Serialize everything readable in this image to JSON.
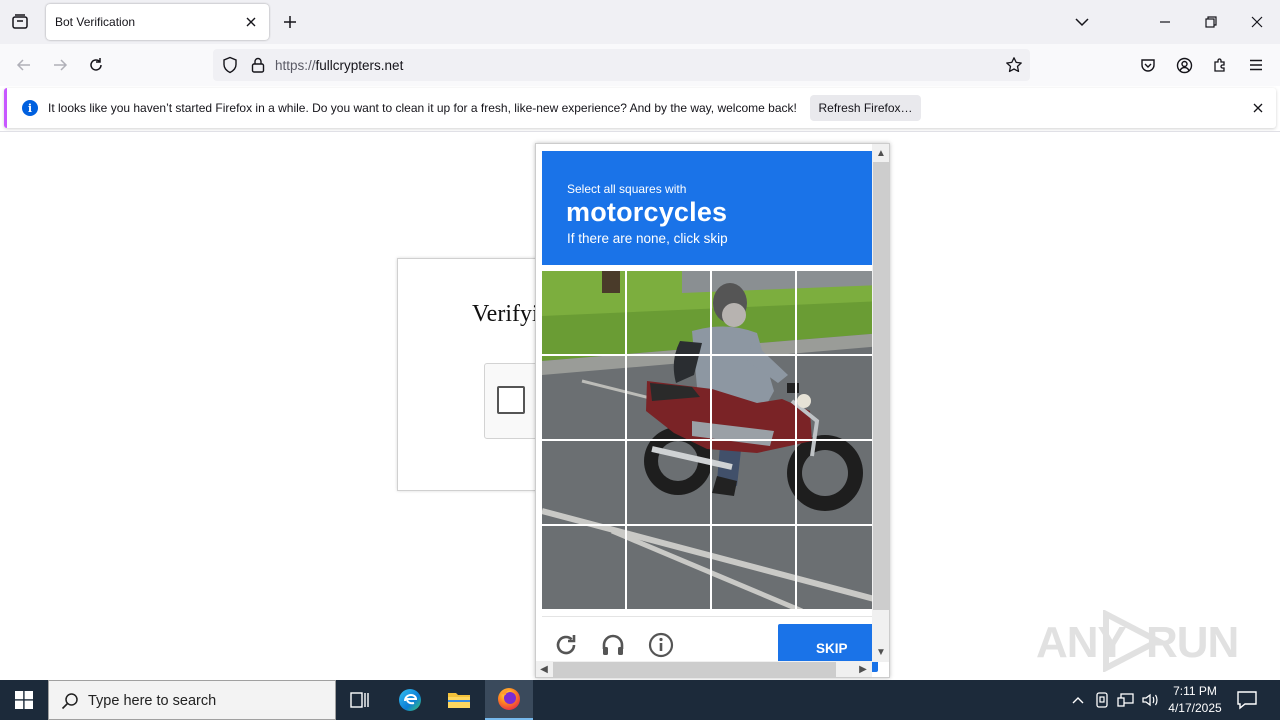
{
  "browser": {
    "tab_title": "Bot Verification",
    "url_prefix": "https://",
    "url_host": "fullcrypters.net"
  },
  "notification": {
    "message": "It looks like you haven’t started Firefox in a while. Do you want to clean it up for a fresh, like-new experience? And by the way, welcome back!",
    "button_label": "Refresh Firefox…",
    "info_glyph": "i"
  },
  "page": {
    "title": "Verifyi"
  },
  "challenge": {
    "instruction_small": "Select all squares with",
    "target_object": "motorcycles",
    "instruction_sub": "If there are none, click skip",
    "skip_label": "SKIP",
    "grid_rows": 4,
    "grid_cols": 4,
    "footer_icons": [
      "reload-icon",
      "audio-headphones-icon",
      "info-icon"
    ]
  },
  "watermark": {
    "left": "ANY",
    "right": "RUN"
  },
  "taskbar": {
    "search_placeholder": "Type here to search",
    "time": "7:11 PM",
    "date": "4/17/2025",
    "apps": [
      "task-view-icon",
      "edge-icon",
      "file-explorer-icon",
      "firefox-icon"
    ]
  },
  "colors": {
    "accent_blue": "#1a73e8",
    "firefox_notice_accent": "#c758ff",
    "taskbar_bg": "#1c2a3a"
  }
}
